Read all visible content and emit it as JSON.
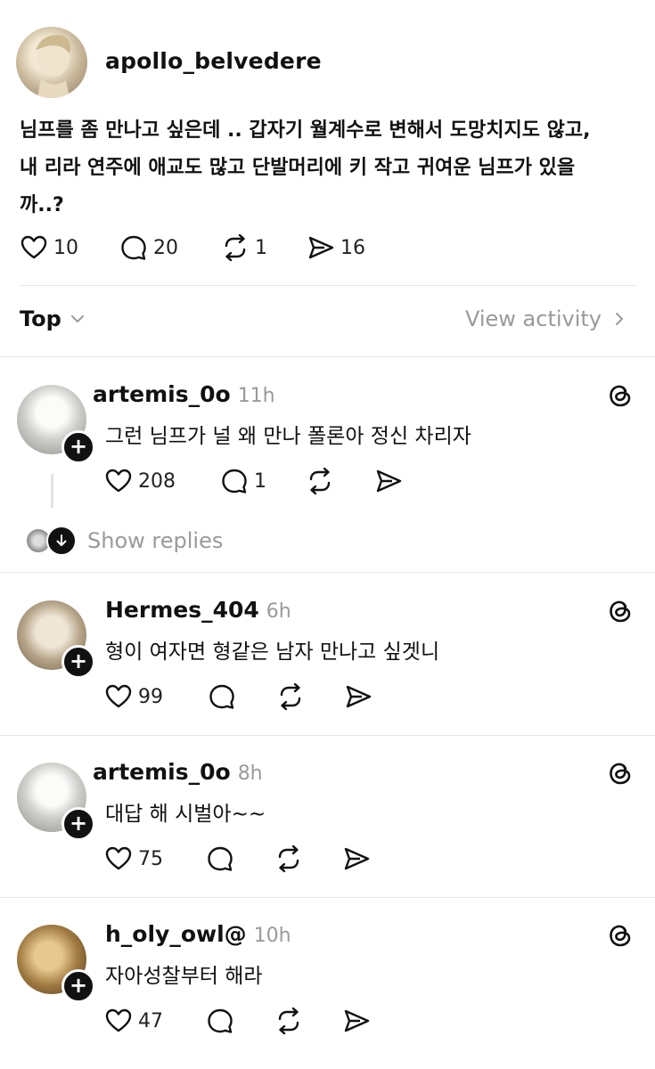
{
  "post": {
    "username": "apollo_belvedere",
    "text_line1": "님프를 좀 만나고 싶은데 .. 갑자기 월계수로 변해서 도망치지도 않고,",
    "text_line2": "내 리라 연주에 애교도 많고 단발머리에 키 작고 귀여운 님프가 있을",
    "text_line3": "까..?",
    "likes": "10",
    "comments": "20",
    "reposts": "1",
    "shares": "16"
  },
  "sort": {
    "label": "Top",
    "view_activity": "View activity"
  },
  "replies": [
    {
      "username": "artemis_0o",
      "time": "11h",
      "text": "그런 님프가 널 왜 만나 폴론아 정신 차리자",
      "likes": "208",
      "comments": "1"
    },
    {
      "username": "Hermes_404",
      "time": "6h",
      "text": "형이 여자면 형같은 남자 만나고 싶겟니",
      "likes": "99"
    },
    {
      "username": "artemis_0o",
      "time": "8h",
      "text": "대답 해 시벌아~~",
      "likes": "75"
    },
    {
      "username": "h_oly_owl@",
      "time": "10h",
      "text": "자아성찰부터 해라",
      "likes": "47"
    }
  ],
  "show_replies": "Show replies",
  "icons": [
    "heart-icon",
    "comment-icon",
    "repost-icon",
    "share-icon",
    "threads-icon",
    "chevron-down-icon",
    "chevron-right-icon",
    "arrow-down-icon",
    "plus-icon"
  ]
}
